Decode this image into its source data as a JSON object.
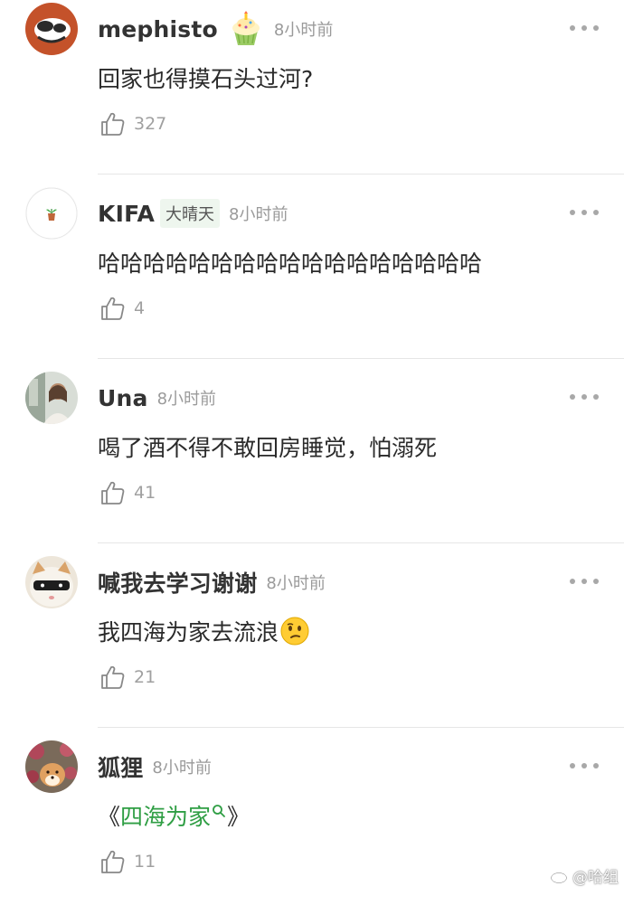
{
  "comments": [
    {
      "username": "mephisto",
      "badge": "cupcake-badge",
      "tag": "",
      "time": "8小时前",
      "text": "回家也得摸石头过河?",
      "likes": "327"
    },
    {
      "username": "KIFA",
      "badge": "",
      "tag": "大晴天",
      "time": "8小时前",
      "text": "哈哈哈哈哈哈哈哈哈哈哈哈哈哈哈哈哈",
      "likes": "4"
    },
    {
      "username": "Una",
      "badge": "",
      "tag": "",
      "time": "8小时前",
      "text": "喝了酒不得不敢回房睡觉，怕溺死",
      "likes": "41"
    },
    {
      "username": "喊我去学习谢谢",
      "badge": "",
      "tag": "",
      "time": "8小时前",
      "text": "我四海为家去流浪",
      "emoji": "confused-face-emoji",
      "likes": "21"
    },
    {
      "username": "狐狸",
      "badge": "",
      "tag": "",
      "time": "8小时前",
      "text_open": "《",
      "link": "四海为家",
      "text_close": "》",
      "likes": "11"
    }
  ],
  "watermark": "@哈组",
  "colors": {
    "link": "#2f9e44",
    "time": "#9a9a9a",
    "divider": "#e6e6e6"
  }
}
